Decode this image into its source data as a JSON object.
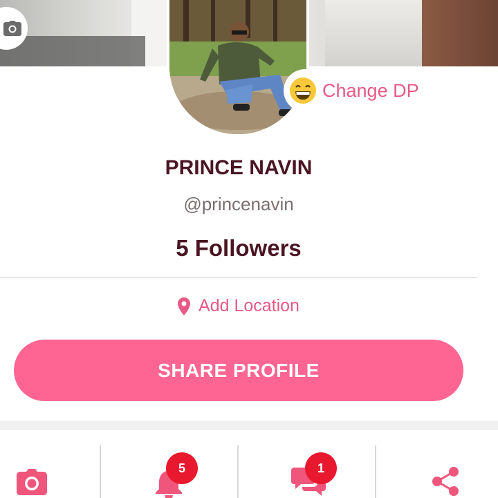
{
  "profile": {
    "name": "PRINCE NAVIN",
    "handle": "@princenavin",
    "followers": "5 Followers"
  },
  "change_dp": {
    "label": "Change DP",
    "icon": "grinning-emoji-icon"
  },
  "location": {
    "label": "Add Location",
    "icon": "location-pin-icon"
  },
  "share_button": {
    "label": "SHARE PROFILE"
  },
  "bottom_tabs": [
    {
      "name": "photos",
      "icon": "camera-icon",
      "badge": ""
    },
    {
      "name": "notifications",
      "icon": "bell-icon",
      "badge": "5"
    },
    {
      "name": "messages",
      "icon": "chat-icon",
      "badge": "1"
    },
    {
      "name": "share",
      "icon": "share-icon",
      "badge": ""
    }
  ],
  "colors": {
    "accent": "#ff6592",
    "accent_text": "#e65a85",
    "name_text": "#4a1522",
    "badge": "#e8182e"
  }
}
